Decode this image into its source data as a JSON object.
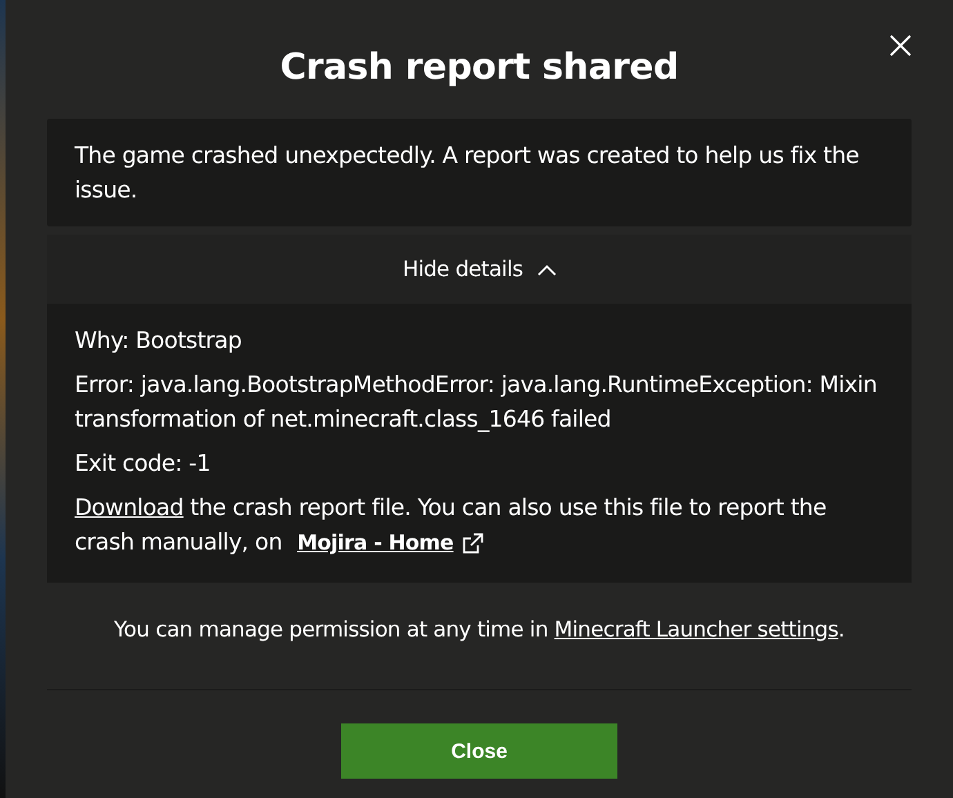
{
  "dialog": {
    "title": "Crash report shared"
  },
  "summary": "The game crashed unexpectedly. A report was created to help us fix the issue.",
  "details": {
    "toggle_label": "Hide details",
    "expanded": true,
    "lines": [
      "Why: Bootstrap",
      "Error: java.lang.BootstrapMethodError: java.lang.RuntimeException: Mixin transformation of net.minecraft.class_1646 failed",
      "Exit code: -1"
    ],
    "download": {
      "link": "Download",
      "text_before_link": "the crash report file. You can also use this file to report the crash manually, on",
      "external_link": "Mojira - Home"
    }
  },
  "permission": {
    "text": "You can manage permission at any time in",
    "link": "Minecraft Launcher settings",
    "end": "."
  },
  "buttons": [
    "Close"
  ]
}
